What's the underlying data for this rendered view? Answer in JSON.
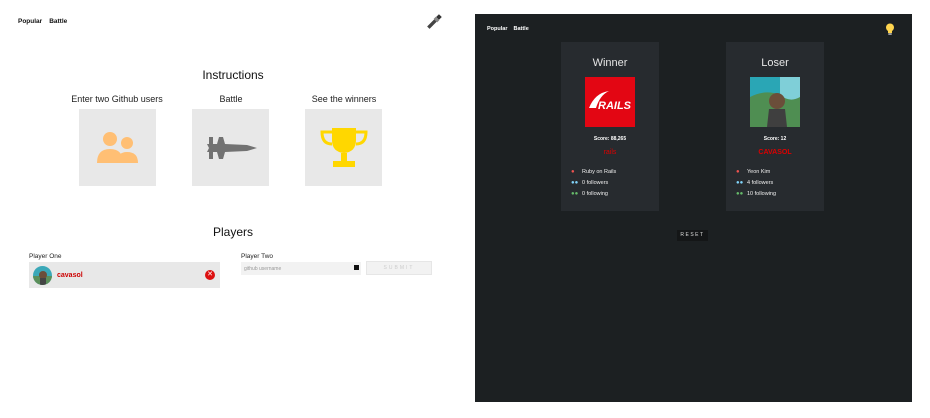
{
  "light": {
    "nav": [
      "Popular",
      "Battle"
    ],
    "instructions_title": "Instructions",
    "instructions": [
      {
        "label": "Enter two Github users",
        "icon": "users-icon",
        "color": "#ffbf74"
      },
      {
        "label": "Battle",
        "icon": "fighter-jet-icon",
        "color": "#727272"
      },
      {
        "label": "See the winners",
        "icon": "trophy-icon",
        "color": "#ffd700"
      }
    ],
    "players_title": "Players",
    "player_one": {
      "label": "Player One",
      "username": "cavasol"
    },
    "player_two": {
      "label": "Player Two",
      "placeholder": "github username"
    },
    "submit_label": "SUBMIT"
  },
  "dark": {
    "nav": [
      "Popular",
      "Battle"
    ],
    "winner": {
      "title": "Winner",
      "avatar_text": "RAILS",
      "score": "Score: 88,265",
      "name": "rails",
      "stats": [
        {
          "icon": "user-icon",
          "color": "#ef5350",
          "text": "Ruby on Rails"
        },
        {
          "icon": "followers-icon",
          "color": "#81d4fa",
          "text": "0 followers"
        },
        {
          "icon": "following-icon",
          "color": "#66bb6a",
          "text": "0 following"
        }
      ]
    },
    "loser": {
      "title": "Loser",
      "score": "Score: 12",
      "name": "CAVASOL",
      "stats": [
        {
          "icon": "user-icon",
          "color": "#ef5350",
          "text": "Yeon Kim"
        },
        {
          "icon": "followers-icon",
          "color": "#81d4fa",
          "text": "4 followers"
        },
        {
          "icon": "following-icon",
          "color": "#66bb6a",
          "text": "10 following"
        }
      ]
    },
    "reset_label": "RESET"
  },
  "colors": {
    "dark_bg": "#1c2022",
    "card_bg": "#272b2f",
    "accent_red": "#cc0000"
  }
}
